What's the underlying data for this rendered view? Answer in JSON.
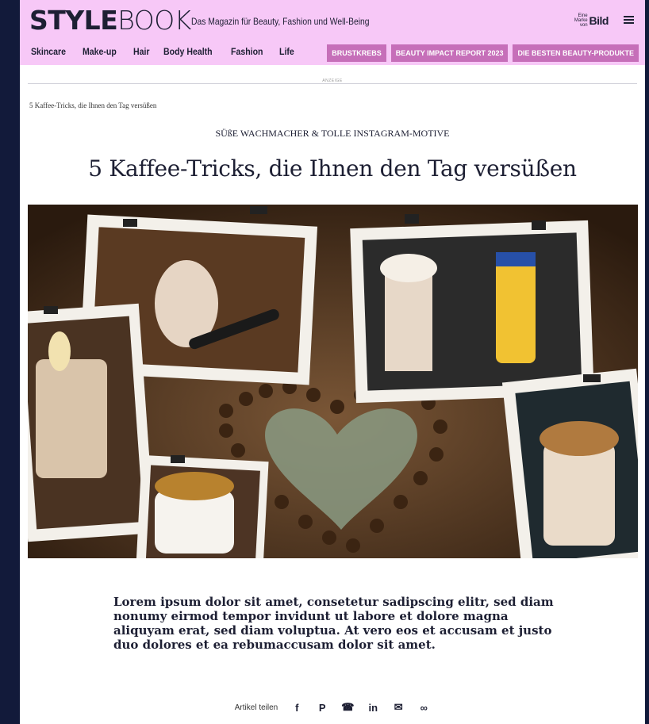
{
  "header": {
    "logo_bold": "STYLE",
    "logo_thin": "BOOK",
    "tagline": "Das Magazin für Beauty, Fashion und Well-Being",
    "brand_small": "Eine Marke von",
    "brand_word": "Bild"
  },
  "nav": {
    "items": [
      "Skincare",
      "Make-up",
      "Hair",
      "Body Health",
      "Fashion",
      "Life"
    ],
    "pills": [
      "BRUSTKREBS",
      "BEAUTY IMPACT REPORT 2023",
      "DIE BESTEN BEAUTY-PRODUKTE"
    ]
  },
  "ad_label": "ANZEIGE",
  "breadcrumb": "5 Kaffee-Tricks, die Ihnen den Tag versüßen",
  "article": {
    "kicker": "SÜßE WACHMACHER & TOLLE INSTAGRAM-MOTIVE",
    "title": "5 Kaffee-Tricks, die Ihnen den Tag versüßen",
    "lead": "Lorem ipsum dolor sit amet, consetetur sadipscing elitr, sed diam nonumy eirmod tempor invidunt ut labore et dolore magna aliquyam erat, sed diam voluptua. At vero eos et accusam et justo duo dolores et ea rebumaccusam dolor sit amet."
  },
  "share": {
    "label": "Artikel teilen",
    "icons": [
      "facebook-icon",
      "pinterest-icon",
      "whatsapp-icon",
      "linkedin-icon",
      "email-icon",
      "link-icon"
    ]
  },
  "colors": {
    "topbar": "#f7c8f7",
    "pill": "#c66fb9",
    "text": "#1d1f33",
    "frame": "#121a3a"
  }
}
